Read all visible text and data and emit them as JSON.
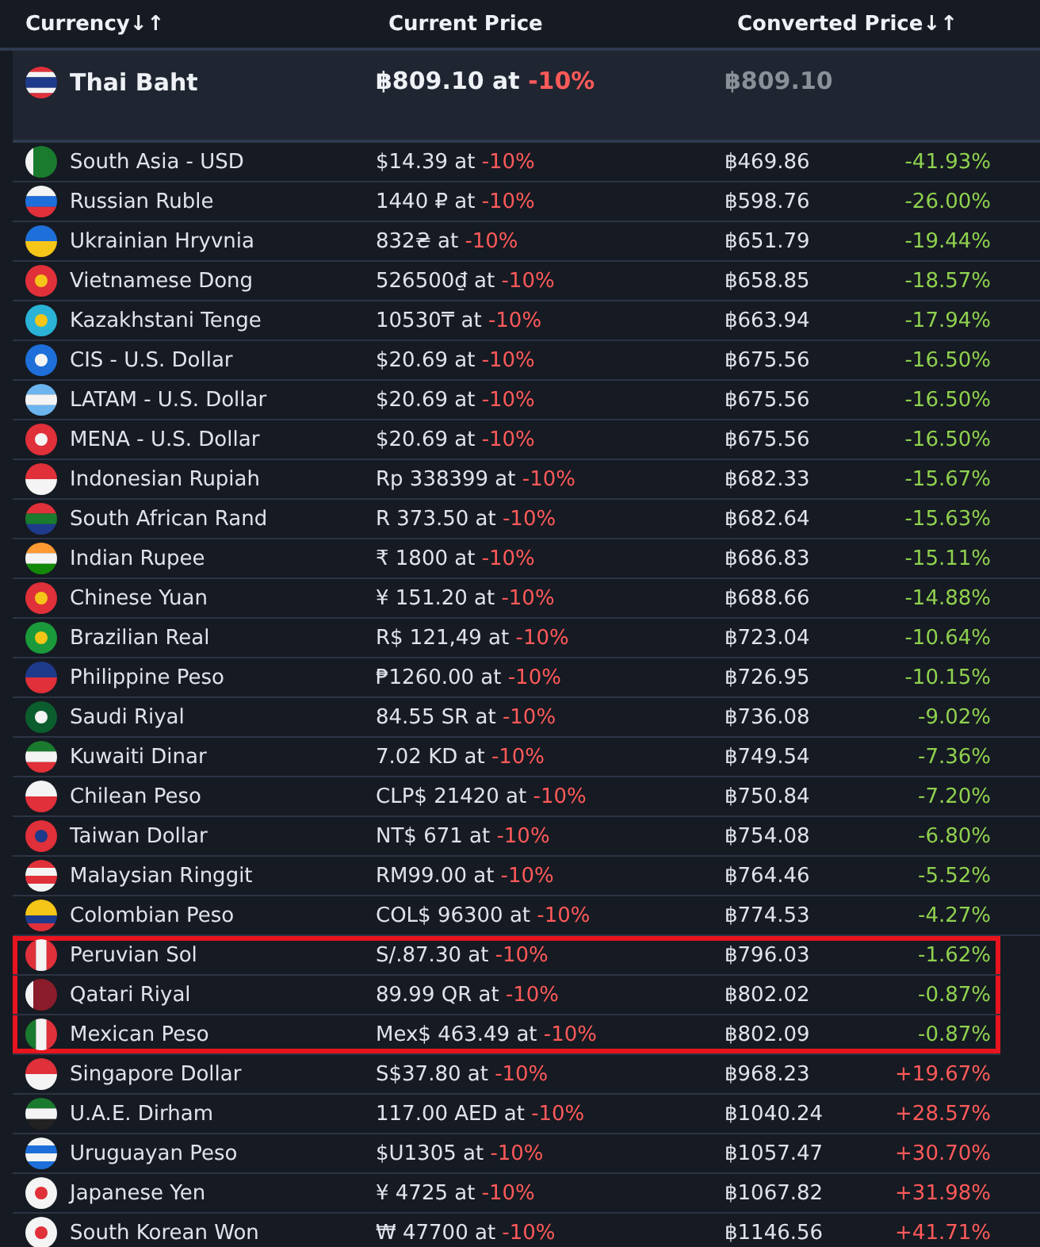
{
  "columns": [
    {
      "label": "Currency",
      "sort": "↓↑"
    },
    {
      "label": "Current Price"
    },
    {
      "label": "Converted Price",
      "sort": "↓↑"
    }
  ],
  "base": {
    "name": "Thai Baht",
    "price": "฿809.10 at ",
    "discount": "-10%",
    "converted": "฿809.10"
  },
  "rows": [
    {
      "name": "South Asia - USD",
      "price": "$14.39 at ",
      "discount": "-10%",
      "converted": "฿469.86",
      "change": "-41.93%",
      "color": "#8fd14f",
      "highlighted": false
    },
    {
      "name": "Russian Ruble",
      "price": "1440 ₽ at ",
      "discount": "-10%",
      "converted": "฿598.76",
      "change": "-26.00%",
      "color": "#8fd14f",
      "highlighted": false
    },
    {
      "name": "Ukrainian Hryvnia",
      "price": "832₴ at ",
      "discount": "-10%",
      "converted": "฿651.79",
      "change": "-19.44%",
      "color": "#8fd14f",
      "highlighted": false
    },
    {
      "name": "Vietnamese Dong",
      "price": "526500₫ at ",
      "discount": "-10%",
      "converted": "฿658.85",
      "change": "-18.57%",
      "color": "#8fd14f",
      "highlighted": false
    },
    {
      "name": "Kazakhstani Tenge",
      "price": "10530₸ at ",
      "discount": "-10%",
      "converted": "฿663.94",
      "change": "-17.94%",
      "color": "#8fd14f",
      "highlighted": false
    },
    {
      "name": "CIS - U.S. Dollar",
      "price": "$20.69 at ",
      "discount": "-10%",
      "converted": "฿675.56",
      "change": "-16.50%",
      "color": "#8fd14f",
      "highlighted": false
    },
    {
      "name": "LATAM - U.S. Dollar",
      "price": "$20.69 at ",
      "discount": "-10%",
      "converted": "฿675.56",
      "change": "-16.50%",
      "color": "#8fd14f",
      "highlighted": false
    },
    {
      "name": "MENA - U.S. Dollar",
      "price": "$20.69 at ",
      "discount": "-10%",
      "converted": "฿675.56",
      "change": "-16.50%",
      "color": "#8fd14f",
      "highlighted": false
    },
    {
      "name": "Indonesian Rupiah",
      "price": "Rp 338399 at ",
      "discount": "-10%",
      "converted": "฿682.33",
      "change": "-15.67%",
      "color": "#8fd14f",
      "highlighted": false
    },
    {
      "name": "South African Rand",
      "price": "R 373.50 at ",
      "discount": "-10%",
      "converted": "฿682.64",
      "change": "-15.63%",
      "color": "#8fd14f",
      "highlighted": false
    },
    {
      "name": "Indian Rupee",
      "price": "₹ 1800 at ",
      "discount": "-10%",
      "converted": "฿686.83",
      "change": "-15.11%",
      "color": "#8fd14f",
      "highlighted": false
    },
    {
      "name": "Chinese Yuan",
      "price": "¥ 151.20 at ",
      "discount": "-10%",
      "converted": "฿688.66",
      "change": "-14.88%",
      "color": "#8fd14f",
      "highlighted": false
    },
    {
      "name": "Brazilian Real",
      "price": "R$ 121,49 at ",
      "discount": "-10%",
      "converted": "฿723.04",
      "change": "-10.64%",
      "color": "#8fd14f",
      "highlighted": false
    },
    {
      "name": "Philippine Peso",
      "price": "₱1260.00 at ",
      "discount": "-10%",
      "converted": "฿726.95",
      "change": "-10.15%",
      "color": "#8fd14f",
      "highlighted": false
    },
    {
      "name": "Saudi Riyal",
      "price": "84.55 SR at ",
      "discount": "-10%",
      "converted": "฿736.08",
      "change": "-9.02%",
      "color": "#8fd14f",
      "highlighted": false
    },
    {
      "name": "Kuwaiti Dinar",
      "price": "7.02 KD at ",
      "discount": "-10%",
      "converted": "฿749.54",
      "change": "-7.36%",
      "color": "#8fd14f",
      "highlighted": false
    },
    {
      "name": "Chilean Peso",
      "price": "CLP$ 21420 at ",
      "discount": "-10%",
      "converted": "฿750.84",
      "change": "-7.20%",
      "color": "#8fd14f",
      "highlighted": false
    },
    {
      "name": "Taiwan Dollar",
      "price": "NT$ 671 at ",
      "discount": "-10%",
      "converted": "฿754.08",
      "change": "-6.80%",
      "color": "#8fd14f",
      "highlighted": false
    },
    {
      "name": "Malaysian Ringgit",
      "price": "RM99.00 at ",
      "discount": "-10%",
      "converted": "฿764.46",
      "change": "-5.52%",
      "color": "#8fd14f",
      "highlighted": false
    },
    {
      "name": "Colombian Peso",
      "price": "COL$ 96300 at ",
      "discount": "-10%",
      "converted": "฿774.53",
      "change": "-4.27%",
      "color": "#8fd14f",
      "highlighted": false
    },
    {
      "name": "Peruvian Sol",
      "price": "S/.87.30 at ",
      "discount": "-10%",
      "converted": "฿796.03",
      "change": "-1.62%",
      "color": "#8fd14f",
      "highlighted": true
    },
    {
      "name": "Qatari Riyal",
      "price": "89.99 QR at ",
      "discount": "-10%",
      "converted": "฿802.02",
      "change": "-0.87%",
      "color": "#8fd14f",
      "highlighted": true
    },
    {
      "name": "Mexican Peso",
      "price": "Mex$ 463.49 at ",
      "discount": "-10%",
      "converted": "฿802.09",
      "change": "-0.87%",
      "color": "#8fd14f",
      "highlighted": true
    },
    {
      "name": "Singapore Dollar",
      "price": "S$37.80 at ",
      "discount": "-10%",
      "converted": "฿968.23",
      "change": "+19.67%",
      "color": "#ff5a5a",
      "highlighted": false
    },
    {
      "name": "U.A.E. Dirham",
      "price": "117.00 AED at ",
      "discount": "-10%",
      "converted": "฿1040.24",
      "change": "+28.57%",
      "color": "#ff5a5a",
      "highlighted": false
    },
    {
      "name": "Uruguayan Peso",
      "price": "$U1305 at ",
      "discount": "-10%",
      "converted": "฿1057.47",
      "change": "+30.70%",
      "color": "#ff5a5a",
      "highlighted": false
    },
    {
      "name": "Japanese Yen",
      "price": "¥ 4725 at ",
      "discount": "-10%",
      "converted": "฿1067.82",
      "change": "+31.98%",
      "color": "#ff5a5a",
      "highlighted": false
    },
    {
      "name": "South Korean Won",
      "price": "₩ 47700 at ",
      "discount": "-10%",
      "converted": "฿1146.56",
      "change": "+41.71%",
      "color": "#ff5a5a",
      "highlighted": false
    }
  ]
}
